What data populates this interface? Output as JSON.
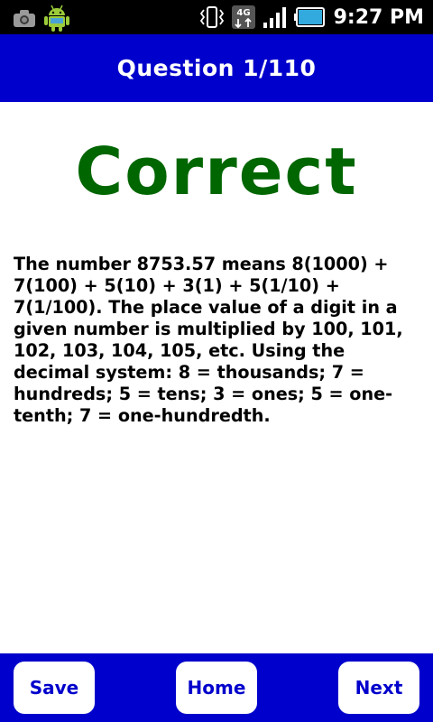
{
  "status_bar": {
    "time": "9:27 PM",
    "network": "4G",
    "icons": [
      "camera-icon",
      "android-icon",
      "vibrate-icon",
      "network-4g-icon",
      "signal-icon",
      "battery-icon"
    ]
  },
  "header": {
    "title": "Question 1/110"
  },
  "main": {
    "result": "Correct",
    "explanation": "The number 8753.57 means 8(1000) + 7(100) + 5(10) + 3(1) + 5(1/10) + 7(1/100). The place value of a digit in a given number is multiplied by 100, 101, 102, 103, 104, 105, etc. Using the decimal system: 8 = thousands; 7 = hundreds; 5 = tens; 3 = ones; 5 = one-tenth; 7 = one-hundredth."
  },
  "footer": {
    "save_label": "Save",
    "home_label": "Home",
    "next_label": "Next"
  },
  "colors": {
    "header_bg": "#0000cc",
    "result_text": "#006600",
    "button_text": "#0000cc"
  }
}
